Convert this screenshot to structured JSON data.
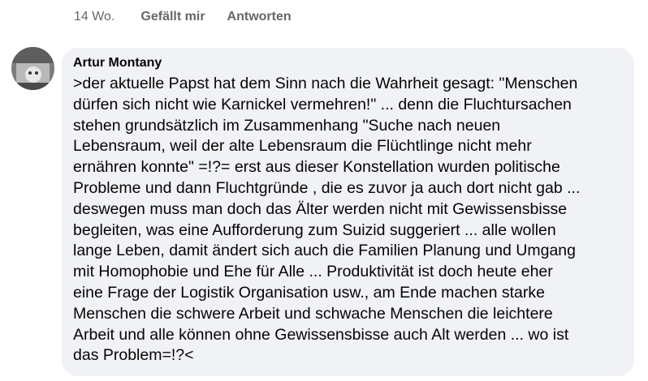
{
  "actions": {
    "time": "14 Wo.",
    "like_label": "Gefällt mir",
    "reply_label": "Antworten"
  },
  "comment": {
    "author": "Artur Montany",
    "avatar_icon": "user-photo-avatar",
    "lines": [
      ">der aktuelle Papst hat dem Sinn nach die Wahrheit gesagt: \"Menschen",
      "dürfen sich nicht wie Karnickel vermehren!\" ... denn die Fluchtursachen",
      "stehen grundsätzlich im Zusammenhang \"Suche nach neuen",
      "Lebensraum, weil der alte Lebensraum die Flüchtlinge nicht mehr",
      "ernähren konnte\" =!?= erst aus dieser Konstellation wurden politische",
      "Probleme und dann Fluchtgründe , die es zuvor ja auch dort nicht gab ...",
      "deswegen muss man doch das Älter werden nicht mit Gewissensbisse",
      "begleiten, was eine Aufforderung zum Suizid suggeriert ... alle wollen",
      "lange Leben, damit ändert sich auch die Familien Planung und Umgang",
      "mit Homophobie und Ehe für Alle ... Produktivität ist doch heute eher",
      "eine Frage der Logistik Organisation usw., am Ende machen starke",
      "Menschen die schwere Arbeit und schwache Menschen die leichtere",
      "Arbeit und alle können ohne Gewissensbisse auch  Alt werden ... wo ist",
      "das Problem=!?<"
    ]
  },
  "colors": {
    "bubble_bg": "#f0f2f5",
    "meta_text": "#65676b",
    "body_text": "#050505"
  }
}
